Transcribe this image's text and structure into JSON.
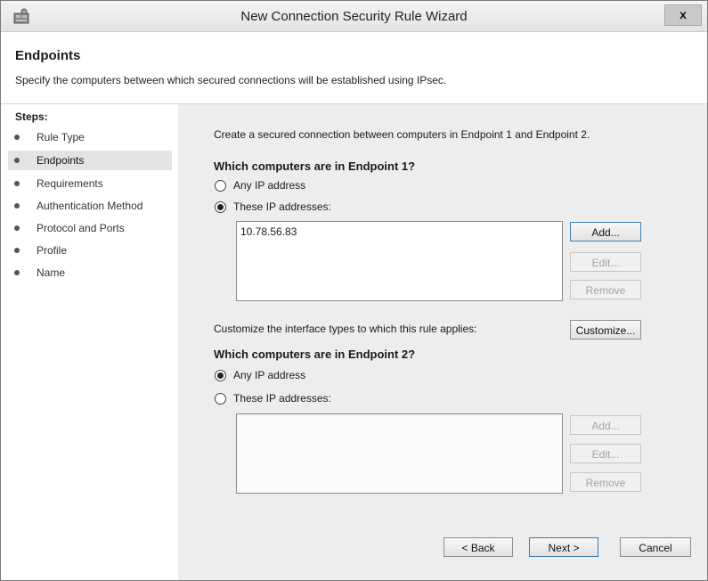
{
  "window": {
    "title": "New Connection Security Rule Wizard",
    "close_label": "x"
  },
  "header": {
    "title": "Endpoints",
    "description": "Specify the computers between which secured connections will be established using IPsec."
  },
  "steps": {
    "label": "Steps:",
    "items": [
      {
        "label": "Rule Type"
      },
      {
        "label": "Endpoints"
      },
      {
        "label": "Requirements"
      },
      {
        "label": "Authentication Method"
      },
      {
        "label": "Protocol and Ports"
      },
      {
        "label": "Profile"
      },
      {
        "label": "Name"
      }
    ],
    "active_index": 1
  },
  "main": {
    "intro": "Create a secured connection between computers in Endpoint 1 and Endpoint 2.",
    "endpoint1": {
      "heading": "Which computers are in Endpoint 1?",
      "option_any": "Any IP address",
      "option_these": "These IP addresses:",
      "selected": "these",
      "addresses": [
        "10.78.56.83"
      ],
      "add_label": "Add...",
      "edit_label": "Edit...",
      "remove_label": "Remove"
    },
    "customize": {
      "text": "Customize the interface types to which this rule applies:",
      "button_label": "Customize..."
    },
    "endpoint2": {
      "heading": "Which computers are in Endpoint 2?",
      "option_any": "Any IP address",
      "option_these": "These IP addresses:",
      "selected": "any",
      "addresses": [],
      "add_label": "Add...",
      "edit_label": "Edit...",
      "remove_label": "Remove"
    }
  },
  "footer": {
    "back_label": "< Back",
    "next_label": "Next >",
    "cancel_label": "Cancel"
  }
}
